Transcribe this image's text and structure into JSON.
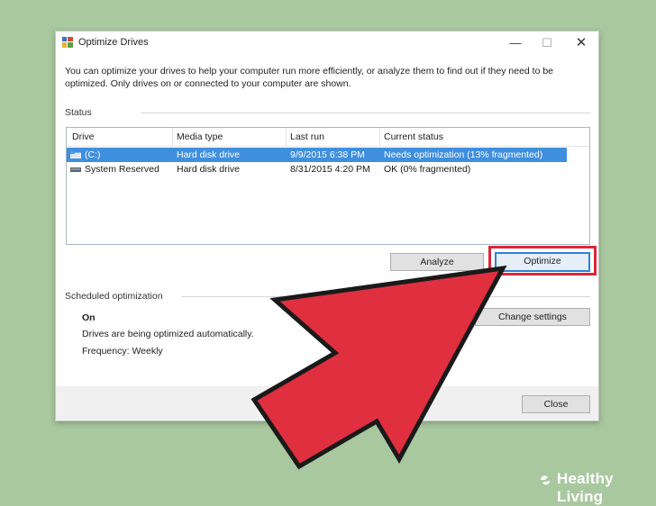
{
  "window": {
    "title": "Optimize Drives",
    "minimize_glyph": "—",
    "maximize_glyph": "☐",
    "close_glyph": "✕"
  },
  "description": "You can optimize your drives to help your computer run more efficiently, or analyze them to find out if they need to be optimized. Only drives on or connected to your computer are shown.",
  "status_section": {
    "label": "Status",
    "columns": [
      "Drive",
      "Media type",
      "Last run",
      "Current status"
    ],
    "rows": [
      {
        "drive": "(C:)",
        "media_type": "Hard disk drive",
        "last_run": "9/9/2015 6:38 PM",
        "status": "Needs optimization (13% fragmented)",
        "selected": true
      },
      {
        "drive": "System Reserved",
        "media_type": "Hard disk drive",
        "last_run": "8/31/2015 4:20 PM",
        "status": "OK (0% fragmented)",
        "selected": false
      }
    ],
    "analyze_label": "Analyze",
    "optimize_label": "Optimize"
  },
  "scheduled": {
    "label": "Scheduled optimization",
    "state": "On",
    "detail": "Drives are being optimized automatically.",
    "frequency": "Frequency: Weekly",
    "change_settings_label": "Change settings"
  },
  "footer": {
    "close_label": "Close"
  },
  "watermark": {
    "text": "Healthy Living"
  },
  "colors": {
    "selection": "#3f8fdf",
    "highlight_border": "#d8283a",
    "arrow_fill": "#e03040",
    "background": "#a9c89f"
  },
  "icons": [
    "app-defrag-icon",
    "drive-icon",
    "pointer-arrow-icon",
    "healthy-living-logo-icon"
  ]
}
